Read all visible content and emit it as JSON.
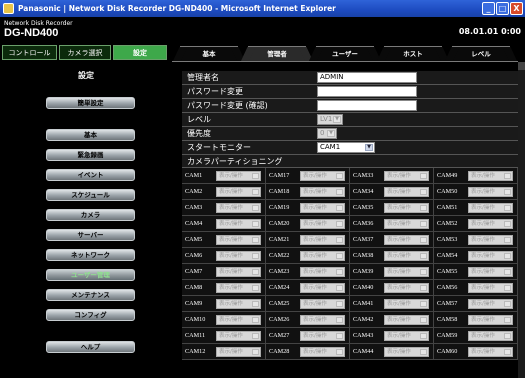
{
  "window": {
    "title": "Panasonic | Network Disk Recorder DG-ND400 - Microsoft Internet Explorer",
    "buttons": [
      "_",
      "□",
      "X"
    ]
  },
  "header": {
    "model_sub": "Network Disk Recorder",
    "model": "DG-ND400",
    "datetime": "08.01.01 0:00"
  },
  "top_tabs": [
    "コントロール",
    "カメラ選択",
    "設定"
  ],
  "sidebar": {
    "title": "設定",
    "items": [
      "簡単設定",
      "基本",
      "緊急録画",
      "イベント",
      "スケジュール",
      "カメラ",
      "サーバー",
      "ネットワーク",
      "ユーザー管理",
      "メンテナンス",
      "コンフィグ",
      "ヘルプ"
    ]
  },
  "main_tabs": [
    "基本",
    "管理者",
    "ユーザー",
    "ホスト",
    "レベル"
  ],
  "form": {
    "admin_name_label": "管理者名",
    "admin_name_value": "ADMIN",
    "password_label": "パスワード変更",
    "password_confirm_label": "パスワード変更 (確認)",
    "level_label": "レベル",
    "level_value": "LV1",
    "priority_label": "優先度",
    "priority_value": "0",
    "start_monitor_label": "スタートモニター",
    "start_monitor_value": "CAM1",
    "camera_partition_label": "カメラパーティショニング"
  },
  "camera_select_value": "表示/操作",
  "cameras": [
    [
      "CAM1",
      "CAM17",
      "CAM33",
      "CAM49"
    ],
    [
      "CAM2",
      "CAM18",
      "CAM34",
      "CAM50"
    ],
    [
      "CAM3",
      "CAM19",
      "CAM35",
      "CAM51"
    ],
    [
      "CAM4",
      "CAM20",
      "CAM36",
      "CAM52"
    ],
    [
      "CAM5",
      "CAM21",
      "CAM37",
      "CAM53"
    ],
    [
      "CAM6",
      "CAM22",
      "CAM38",
      "CAM54"
    ],
    [
      "CAM7",
      "CAM23",
      "CAM39",
      "CAM55"
    ],
    [
      "CAM8",
      "CAM24",
      "CAM40",
      "CAM56"
    ],
    [
      "CAM9",
      "CAM25",
      "CAM41",
      "CAM57"
    ],
    [
      "CAM10",
      "CAM26",
      "CAM42",
      "CAM58"
    ],
    [
      "CAM11",
      "CAM27",
      "CAM43",
      "CAM59"
    ],
    [
      "CAM12",
      "CAM28",
      "CAM44",
      "CAM60"
    ]
  ]
}
